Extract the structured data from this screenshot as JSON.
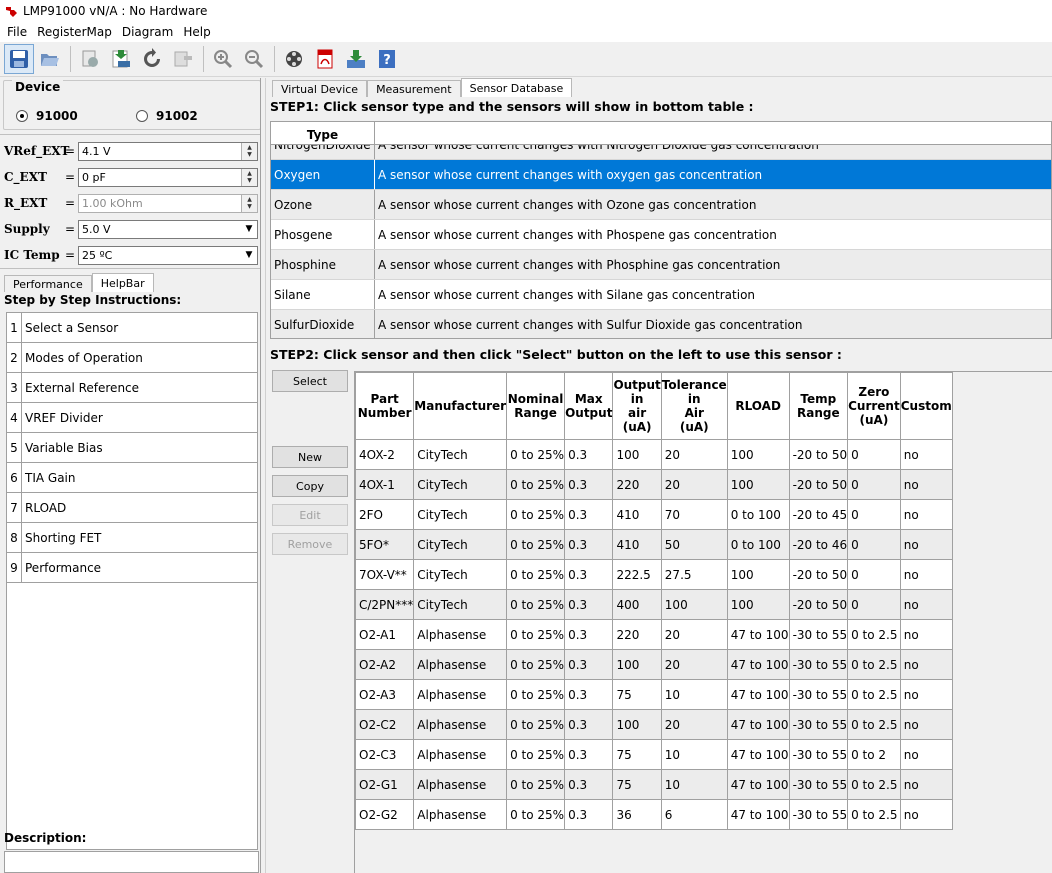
{
  "window": {
    "title": "LMP91000 vN/A : No Hardware"
  },
  "menu": [
    "File",
    "RegisterMap",
    "Diagram",
    "Help"
  ],
  "toolbar": {
    "icons": [
      "save-icon",
      "open-icon",
      "export-icon",
      "export-csv-icon",
      "refresh-icon",
      "import-icon",
      "zoom-in-icon",
      "zoom-out-icon",
      "film-icon",
      "pdf-icon",
      "download-icon",
      "help-icon"
    ]
  },
  "device": {
    "legend": "Device",
    "options": [
      "91000",
      "91002"
    ],
    "selected": "91000"
  },
  "fields": {
    "vref": {
      "label": "VRef_EXT",
      "eq": "=",
      "value": "4.1 V"
    },
    "cext": {
      "label": "C_EXT",
      "eq": "=",
      "value": "0 pF"
    },
    "rext": {
      "label": "R_EXT",
      "eq": "=",
      "value": "1.00 kOhm"
    },
    "supply": {
      "label": "Supply",
      "eq": "=",
      "value": "5.0 V"
    },
    "ictemp": {
      "label": "IC Temp",
      "eq": "=",
      "value": "25 ºC"
    }
  },
  "lefttabs": [
    "Performance",
    "HelpBar"
  ],
  "instructions": {
    "title": "Step by Step Instructions:",
    "steps": [
      {
        "num": "1",
        "label": "Select a Sensor"
      },
      {
        "num": "2",
        "label": "Modes of Operation"
      },
      {
        "num": "3",
        "label": "External Reference"
      },
      {
        "num": "4",
        "label": "VREF Divider"
      },
      {
        "num": "5",
        "label": "Variable Bias"
      },
      {
        "num": "6",
        "label": "TIA Gain"
      },
      {
        "num": "7",
        "label": "RLOAD"
      },
      {
        "num": "8",
        "label": "Shorting FET"
      },
      {
        "num": "9",
        "label": "Performance"
      }
    ]
  },
  "description": {
    "title": "Description:"
  },
  "righttabs": [
    "Virtual Device",
    "Measurement",
    "Sensor Database"
  ],
  "step1": "STEP1: Click sensor type and the sensors will show in bottom table :",
  "typetable": {
    "header": "Type",
    "rows": [
      {
        "type": "NitrogenDioxide",
        "desc": "A sensor whose current changes with Nitrogen Dioxide gas concentration"
      },
      {
        "type": "Oxygen",
        "desc": "A sensor whose current changes with oxygen gas concentration"
      },
      {
        "type": "Ozone",
        "desc": "A sensor whose current changes with Ozone gas concentration"
      },
      {
        "type": "Phosgene",
        "desc": "A sensor whose current changes with Phospene gas concentration"
      },
      {
        "type": "Phosphine",
        "desc": "A sensor whose current changes with Phosphine gas concentration"
      },
      {
        "type": "Silane",
        "desc": "A sensor whose current changes with Silane gas concentration"
      },
      {
        "type": "SulfurDioxide",
        "desc": "A sensor whose current changes with Sulfur Dioxide gas concentration"
      }
    ],
    "selected": "Oxygen"
  },
  "step2": "STEP2: Click sensor and then click \"Select\" button on the left to use this sensor :",
  "buttons": {
    "select": "Select",
    "new": "New",
    "copy": "Copy",
    "edit": "Edit",
    "remove": "Remove"
  },
  "sensortable": {
    "headers": [
      [
        "Part",
        "Number"
      ],
      [
        "Manufacturer"
      ],
      [
        "Nominal",
        "Range"
      ],
      [
        "Max",
        "Output"
      ],
      [
        "Output",
        "in",
        "air",
        "(uA)"
      ],
      [
        "Tolerance",
        "in",
        "Air",
        "(uA)"
      ],
      [
        "RLOAD"
      ],
      [
        "Temp",
        "Range"
      ],
      [
        "Zero",
        "Current",
        "(uA)"
      ],
      [
        "Custom"
      ]
    ],
    "rows": [
      [
        "4OX-2",
        "CityTech",
        "0 to 25%",
        "0.3",
        "100",
        "20",
        "100",
        "-20 to 50",
        "0",
        "no"
      ],
      [
        "4OX-1",
        "CityTech",
        "0 to 25%",
        "0.3",
        "220",
        "20",
        "100",
        "-20 to 50",
        "0",
        "no"
      ],
      [
        "2FO",
        "CityTech",
        "0 to 25%",
        "0.3",
        "410",
        "70",
        "0 to 100",
        "-20 to 45",
        "0",
        "no"
      ],
      [
        "5FO*",
        "CityTech",
        "0 to 25%",
        "0.3",
        "410",
        "50",
        "0 to 100",
        "-20 to 46",
        "0",
        "no"
      ],
      [
        "7OX-V**",
        "CityTech",
        "0 to 25%",
        "0.3",
        "222.5",
        "27.5",
        "100",
        "-20 to 50",
        "0",
        "no"
      ],
      [
        "C/2PN***",
        "CityTech",
        "0 to 25%",
        "0.3",
        "400",
        "100",
        "100",
        "-20 to 50",
        "0",
        "no"
      ],
      [
        "O2-A1",
        "Alphasense",
        "0 to 25%",
        "0.3",
        "220",
        "20",
        "47 to 100",
        "-30 to 55",
        "0 to 2.5",
        "no"
      ],
      [
        "O2-A2",
        "Alphasense",
        "0 to 25%",
        "0.3",
        "100",
        "20",
        "47 to 100",
        "-30 to 55",
        "0 to 2.5",
        "no"
      ],
      [
        "O2-A3",
        "Alphasense",
        "0 to 25%",
        "0.3",
        "75",
        "10",
        "47 to 100",
        "-30 to 55",
        "0 to 2.5",
        "no"
      ],
      [
        "O2-C2",
        "Alphasense",
        "0 to 25%",
        "0.3",
        "100",
        "20",
        "47 to 100",
        "-30 to 55",
        "0 to 2.5",
        "no"
      ],
      [
        "O2-C3",
        "Alphasense",
        "0 to 25%",
        "0.3",
        "75",
        "10",
        "47 to 100",
        "-30 to 55",
        "0 to 2",
        "no"
      ],
      [
        "O2-G1",
        "Alphasense",
        "0 to 25%",
        "0.3",
        "75",
        "10",
        "47 to 100",
        "-30 to 55",
        "0 to 2.5",
        "no"
      ],
      [
        "O2-G2",
        "Alphasense",
        "0 to 25%",
        "0.3",
        "36",
        "6",
        "47 to 100",
        "-30 to 55",
        "0 to 2.5",
        "no"
      ]
    ]
  },
  "colors": {
    "selection": "#0078d7",
    "altrow": "#ececec",
    "border": "#a0a0a0"
  }
}
